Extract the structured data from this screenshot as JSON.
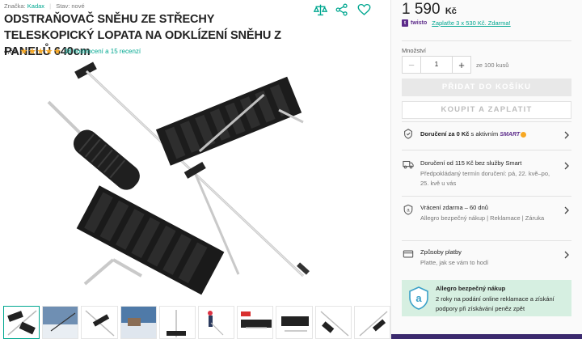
{
  "meta": {
    "brand_label": "Značka:",
    "brand": "Kadax",
    "state_label": "Stav:",
    "state": "nové"
  },
  "title": "ODSTRAŇOVAČ SNĚHU ZE STŘECHY TELESKOPICKÝ LOPATA NA ODKLÍZENÍ SNĚHU Z PANELŮ 640cm",
  "rating": {
    "value": "4,63",
    "stars": "★★★★★",
    "link": "38 hodnocení a 15 recenzí"
  },
  "price": {
    "amount": "1 590",
    "currency": "Kč"
  },
  "twisto": {
    "brand": "twisto",
    "text": "Zaplaťte 3 x 530 Kč. Zdarma!"
  },
  "quantity": {
    "label": "Množství",
    "minus": "−",
    "value": "1",
    "plus": "+",
    "of": "ze 100 kusů"
  },
  "buttons": {
    "add": "PŘIDAT DO KOŠÍKU",
    "buy": "KOUPIT A ZAPLATIT"
  },
  "delivery": {
    "free_prefix": "Doručení za 0 Kč",
    "free_suffix": "s aktivním",
    "smart": "SMART",
    "from_text": "Doručení od 115 Kč bez služby Smart",
    "from_sub": "Předpokládaný termín doručení: pá, 22. kvě–po, 25. kvě u vás"
  },
  "returns": {
    "title": "Vrácení zdarma – 60 dnů",
    "sub": "Allegro bezpečný nákup | Reklamace | Záruka"
  },
  "payment": {
    "title": "Způsoby platby",
    "sub": "Platte, jak se vám to hodí"
  },
  "safe": {
    "title": "Allegro bezpečný nákup",
    "sub": "2 roky na podání online reklamace a získání podpory při získávání peněz zpět"
  },
  "colors": {
    "accent": "#00a790",
    "star": "#f7a823",
    "twisto": "#5c2b8a",
    "safe_bg": "#d6efe1"
  },
  "icons": [
    "compare-icon",
    "share-icon",
    "heart-icon",
    "truck-icon",
    "return-icon",
    "card-icon",
    "chevron-right-icon",
    "shield-icon"
  ]
}
